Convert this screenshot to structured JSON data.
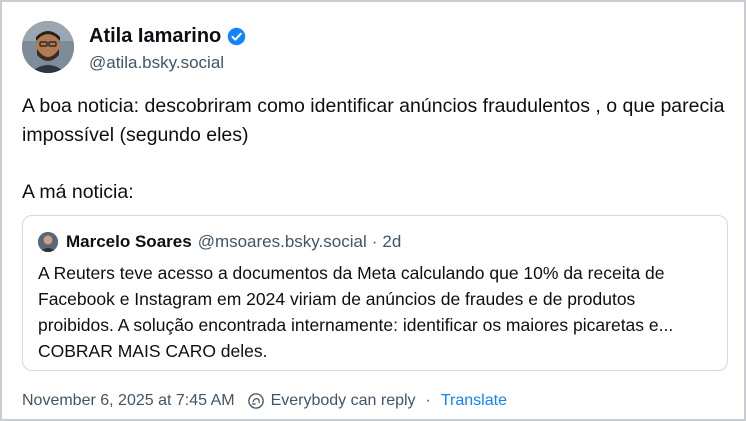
{
  "author": {
    "display_name": "Atila Iamarino",
    "handle": "@atila.bsky.social",
    "verified": true
  },
  "post": {
    "paragraph_1": "A boa noticia: descobriram como identificar anúncios fraudulentos , o que parecia impossível (segundo eles)",
    "paragraph_2": "A má noticia:"
  },
  "quoted_post": {
    "display_name": "Marcelo Soares",
    "handle": "@msoares.bsky.social",
    "separator": "·",
    "age": "2d",
    "text": "A Reuters teve acesso a documentos da Meta calculando que 10% da receita de Facebook e Instagram em 2024 viriam de anúncios de fraudes e de produtos proibidos. A solução encontrada internamente: identificar os maiores picaretas e... COBRAR MAIS CARO deles."
  },
  "footer": {
    "timestamp": "November 6, 2025 at 7:45 AM",
    "reply_setting": "Everybody can reply",
    "separator": "·",
    "translate_label": "Translate"
  },
  "colors": {
    "accent": "#1083fe",
    "muted_text": "#425466",
    "border": "#d4d9de"
  }
}
